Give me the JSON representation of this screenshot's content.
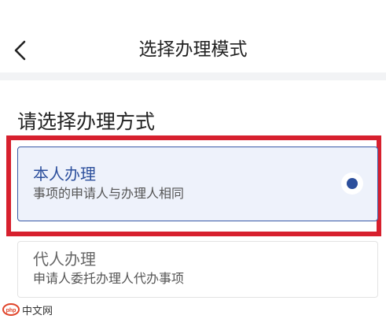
{
  "header": {
    "title": "选择办理模式",
    "back_icon": "chevron-left-icon"
  },
  "section": {
    "heading": "请选择办理方式"
  },
  "options": [
    {
      "title": "本人办理",
      "subtitle": "事项的申请人与办理人相同",
      "selected": true
    },
    {
      "title": "代人办理",
      "subtitle": "申请人委托办理人代办事项",
      "selected": false
    }
  ],
  "watermark": {
    "text": "中文网",
    "logo": "php-logo"
  },
  "colors": {
    "accent": "#2c4f9c",
    "highlight_frame": "#d7202e",
    "selected_bg": "#eef2fb"
  }
}
